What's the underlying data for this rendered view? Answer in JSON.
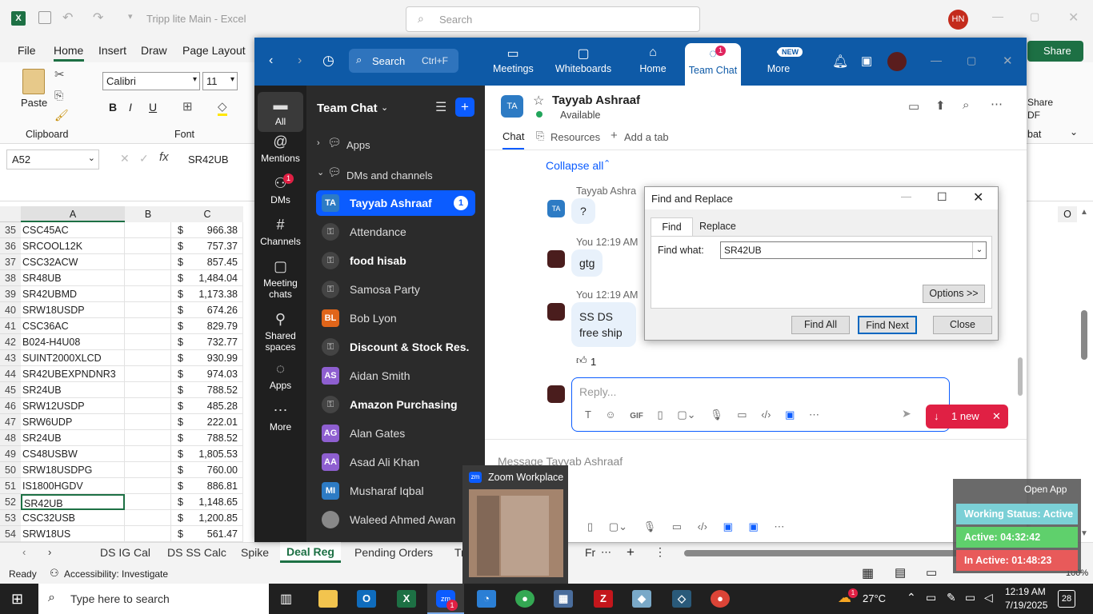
{
  "excel": {
    "title": "Tripp lite Main  -  Excel",
    "search_placeholder": "Search",
    "user_initials": "HN",
    "tabs": [
      "File",
      "Home",
      "Insert",
      "Draw",
      "Page Layout"
    ],
    "share_label": "Share",
    "ribbon": {
      "paste": "Paste",
      "clipboard": "Clipboard",
      "font_name": "Calibri",
      "font_size": "11",
      "font_group": "Font",
      "share_partial": "Share",
      "pdf_partial": "DF",
      "acrobat_partial": "bat"
    },
    "name_box": "A52",
    "formula": "SR42UB",
    "columns": [
      "A",
      "B",
      "C"
    ],
    "col_o": "O",
    "rows": [
      {
        "n": "35",
        "a": "CSC45AC",
        "d": "$",
        "v": "966.38"
      },
      {
        "n": "36",
        "a": "SRCOOL12K",
        "d": "$",
        "v": "757.37"
      },
      {
        "n": "37",
        "a": "CSC32ACW",
        "d": "$",
        "v": "857.45"
      },
      {
        "n": "38",
        "a": "SR48UB",
        "d": "$",
        "v": "1,484.04"
      },
      {
        "n": "39",
        "a": "SR42UBMD",
        "d": "$",
        "v": "1,173.38"
      },
      {
        "n": "40",
        "a": "SRW18USDP",
        "d": "$",
        "v": "674.26"
      },
      {
        "n": "41",
        "a": "CSC36AC",
        "d": "$",
        "v": "829.79"
      },
      {
        "n": "42",
        "a": "B024-H4U08",
        "d": "$",
        "v": "732.77"
      },
      {
        "n": "43",
        "a": "SUINT2000XLCD",
        "d": "$",
        "v": "930.99"
      },
      {
        "n": "44",
        "a": "SR42UBEXPNDNR3",
        "d": "$",
        "v": "974.03"
      },
      {
        "n": "45",
        "a": "SR24UB",
        "d": "$",
        "v": "788.52"
      },
      {
        "n": "46",
        "a": "SRW12USDP",
        "d": "$",
        "v": "485.28"
      },
      {
        "n": "47",
        "a": "SRW6UDP",
        "d": "$",
        "v": "222.01"
      },
      {
        "n": "48",
        "a": "SR24UB",
        "d": "$",
        "v": "788.52"
      },
      {
        "n": "49",
        "a": "CS48USBW",
        "d": "$",
        "v": "1,805.53"
      },
      {
        "n": "50",
        "a": "SRW18USDPG",
        "d": "$",
        "v": "760.00"
      },
      {
        "n": "51",
        "a": "IS1800HGDV",
        "d": "$",
        "v": "886.81"
      },
      {
        "n": "52",
        "a": "SR42UB",
        "d": "$",
        "v": "1,148.65"
      },
      {
        "n": "53",
        "a": "CSC32USB",
        "d": "$",
        "v": "1,200.85"
      },
      {
        "n": "54",
        "a": "SRW18US",
        "d": "$",
        "v": "561.47"
      }
    ],
    "sheet_tabs": [
      "DS IG Cal",
      "DS SS Calc",
      "Spike",
      "Deal Reg",
      "Pending Orders",
      "Tr",
      "Fr"
    ],
    "status_ready": "Ready",
    "accessibility": "Accessibility: Investigate",
    "zoom_partial": "100%"
  },
  "zoom": {
    "search_label": "Search",
    "search_shortcut": "Ctrl+F",
    "nav": [
      {
        "label": "Meetings"
      },
      {
        "label": "Whiteboards"
      },
      {
        "label": "Home"
      },
      {
        "label": "Team Chat",
        "badge": "1"
      },
      {
        "label": "More",
        "badge": "NEW"
      }
    ],
    "rail": [
      "All",
      "Mentions",
      "DMs",
      "Channels",
      "Meeting chats",
      "Shared spaces",
      "Apps",
      "More"
    ],
    "rail_dm_badge": "1",
    "list_title": "Team Chat",
    "apps": "Apps",
    "dms_header": "DMs and channels",
    "items": [
      {
        "name": "Tayyab Ashraaf",
        "av": "TA",
        "badge": "1"
      },
      {
        "name": "Attendance"
      },
      {
        "name": "food hisab"
      },
      {
        "name": "Samosa Party"
      },
      {
        "name": "Bob Lyon",
        "av": "BL"
      },
      {
        "name": "Discount & Stock Res..."
      },
      {
        "name": "Aidan Smith",
        "av": "AS"
      },
      {
        "name": "Amazon Purchasing"
      },
      {
        "name": "Alan Gates",
        "av": "AG"
      },
      {
        "name": "Asad Ali Khan",
        "av": "AA"
      },
      {
        "name": "Musharaf Iqbal",
        "av": "MI"
      },
      {
        "name": "Waleed Ahmed Awan"
      }
    ],
    "chat": {
      "contact_initials": "TA",
      "contact_name": "Tayyab Ashraaf",
      "status": "Available",
      "tabs": [
        "Chat",
        "Resources",
        "Add a tab"
      ],
      "collapse": "Collapse all",
      "msg1_sender": "Tayyab Ashra",
      "msg1_text": "?",
      "msg2_meta": "You 12:19 AM",
      "msg2_text": "gtg",
      "msg3_meta": "You 12:19 AM",
      "msg3_line1": "SS DS",
      "msg3_line2": "free ship",
      "reaction": "1",
      "reply_placeholder": "Reply...",
      "new_label": "1 new",
      "composer_placeholder": "Message Tayyab Ashraaf"
    },
    "thumb_title": "Zoom Workplace"
  },
  "find_dialog": {
    "title": "Find and Replace",
    "tab_find": "Find",
    "tab_replace": "Replace",
    "find_label": "Find what:",
    "find_value": "SR42UB",
    "options": "Options >>",
    "find_all": "Find All",
    "find_next": "Find Next",
    "close": "Close"
  },
  "widget": {
    "open_app": "Open App",
    "working": "Working Status: Active",
    "active": "Active: 04:32:42",
    "inactive": "In Active: 01:48:23"
  },
  "taskbar": {
    "search_placeholder": "Type here to search",
    "temp": "27°C",
    "time": "12:19 AM",
    "date": "7/19/2025",
    "notif": "28",
    "weather_badge": "1",
    "zoom_badge": "1"
  }
}
